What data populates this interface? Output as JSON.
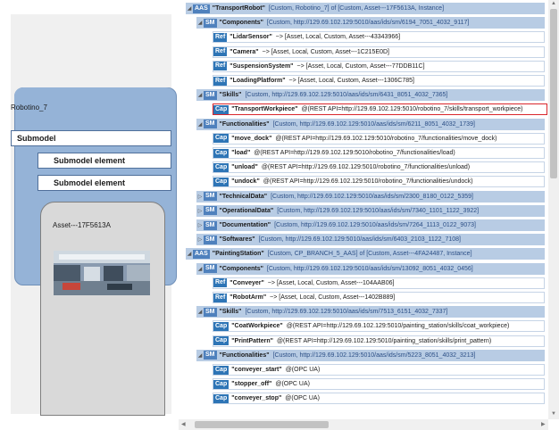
{
  "left_panel": {
    "aas_label": "Robotino_7",
    "submodel_label": "Submodel",
    "submodel_element_1": "Submodel element",
    "submodel_element_2": "Submodel element",
    "asset_label": "Asset---17F5613A"
  },
  "tree": [
    {
      "level": 0,
      "twisty": "◢",
      "tag": "AAS",
      "name": "\"TransportRobot\"",
      "details": "[Custom, Robotino_7] of [Custom, Asset---17F5613A, Instance]"
    },
    {
      "level": 1,
      "twisty": "◢",
      "tag": "SM",
      "name": "\"Components\"",
      "details": "[Custom, http://129.69.102.129:5010/aas/ids/sm/6194_7051_4032_9117]"
    },
    {
      "level": 2,
      "twisty": "",
      "tag": "Ref",
      "name": "\"LidarSensor\"",
      "details": "~> [Asset, Local, Custom, Asset---43343966]"
    },
    {
      "level": 2,
      "twisty": "",
      "tag": "Ref",
      "name": "\"Camera\"",
      "details": "~> [Asset, Local, Custom, Asset---1C215E0D]"
    },
    {
      "level": 2,
      "twisty": "",
      "tag": "Ref",
      "name": "\"SuspensionSystem\"",
      "details": "~> [Asset, Local, Custom, Asset---77DDB11C]"
    },
    {
      "level": 2,
      "twisty": "",
      "tag": "Ref",
      "name": "\"LoadingPlatform\"",
      "details": "~> [Asset, Local, Custom, Asset---1306C785]"
    },
    {
      "level": 1,
      "twisty": "◢",
      "tag": "SM",
      "name": "\"Skills\"",
      "details": "[Custom, http://129.69.102.129:5010/aas/ids/sm/6431_8051_4032_7365]"
    },
    {
      "level": 2,
      "twisty": "",
      "tag": "Cap",
      "name": "\"TransportWorkpiece\"",
      "details": "@(REST API=http://129.69.102.129:5010/robotino_7/skills/transport_workpiece)",
      "highlight": true
    },
    {
      "level": 1,
      "twisty": "◢",
      "tag": "SM",
      "name": "\"Functionalities\"",
      "details": "[Custom, http://129.69.102.129:5010/aas/ids/sm/6211_8051_4032_1739]"
    },
    {
      "level": 2,
      "twisty": "",
      "tag": "Cap",
      "name": "\"move_dock\"",
      "details": "@(REST API=http://129.69.102.129:5010/robotino_7/functionalities/move_dock)"
    },
    {
      "level": 2,
      "twisty": "",
      "tag": "Cap",
      "name": "\"load\"",
      "details": "@(REST API=http://129.69.102.129:5010/robotino_7/functionalities/load)"
    },
    {
      "level": 2,
      "twisty": "",
      "tag": "Cap",
      "name": "\"unload\"",
      "details": "@(REST API=http://129.69.102.129:5010/robotino_7/functionalities/unload)"
    },
    {
      "level": 2,
      "twisty": "",
      "tag": "Cap",
      "name": "\"undock\"",
      "details": "@(REST API=http://129.69.102.129:5010/robotino_7/functionalities/undock)"
    },
    {
      "level": 1,
      "twisty": "▷",
      "tag": "SM",
      "name": "\"TechnicalData\"",
      "details": "[Custom, http://129.69.102.129:5010/aas/ids/sm/2300_8180_0122_5359]"
    },
    {
      "level": 1,
      "twisty": "▷",
      "tag": "SM",
      "name": "\"OperationalData\"",
      "details": "[Custom, http://129.69.102.129:5010/aas/ids/sm/7340_1101_1122_3922]"
    },
    {
      "level": 1,
      "twisty": "▷",
      "tag": "SM",
      "name": "\"Documentation\"",
      "details": "[Custom, http://129.69.102.129:5010/aas/ids/sm/7264_1113_0122_9073]"
    },
    {
      "level": 1,
      "twisty": "▷",
      "tag": "SM",
      "name": "\"Softwares\"",
      "details": "[Custom, http://129.69.102.129:5010/aas/ids/sm/6403_2103_1122_7108]"
    },
    {
      "level": 0,
      "twisty": "◢",
      "tag": "AAS",
      "name": "\"PaintingStation\"",
      "details": "[Custom, CP_BRANCH_5_AAS] of [Custom, Asset---4FA24487, Instance]"
    },
    {
      "level": 1,
      "twisty": "◢",
      "tag": "SM",
      "name": "\"Components\"",
      "details": "[Custom, http://129.69.102.129:5010/aas/ids/sm/13092_8051_4032_0456]"
    },
    {
      "level": 2,
      "twisty": "",
      "tag": "Ref",
      "name": "\"Conveyer\"",
      "details": "~> [Asset, Local, Custom, Asset---104AAB06]"
    },
    {
      "level": 2,
      "twisty": "",
      "tag": "Ref",
      "name": "\"RobotArm\"",
      "details": "~> [Asset, Local, Custom, Asset---1402B889]"
    },
    {
      "level": 1,
      "twisty": "◢",
      "tag": "SM",
      "name": "\"Skills\"",
      "details": "[Custom, http://129.69.102.129:5010/aas/ids/sm/7513_6151_4032_7337]"
    },
    {
      "level": 2,
      "twisty": "",
      "tag": "Cap",
      "name": "\"CoatWorkpiece\"",
      "details": "@(REST API=http://129.69.102.129:5010/painting_station/skills/coat_workpiece)"
    },
    {
      "level": 2,
      "twisty": "",
      "tag": "Cap",
      "name": "\"PrintPattern\"",
      "details": "@(REST API=http://129.69.102.129:5010/painting_station/skills/print_pattern)"
    },
    {
      "level": 1,
      "twisty": "◢",
      "tag": "SM",
      "name": "\"Functionalities\"",
      "details": "[Custom, http://129.69.102.129:5010/aas/ids/sm/5223_8051_4032_3213]"
    },
    {
      "level": 2,
      "twisty": "",
      "tag": "Cap",
      "name": "\"conveyer_start\"",
      "details": "@(OPC UA)"
    },
    {
      "level": 2,
      "twisty": "",
      "tag": "Cap",
      "name": "\"stopper_off\"",
      "details": "@(OPC UA)"
    },
    {
      "level": 2,
      "twisty": "",
      "tag": "Cap",
      "name": "\"conveyer_stop\"",
      "details": "@(OPC UA)"
    }
  ]
}
